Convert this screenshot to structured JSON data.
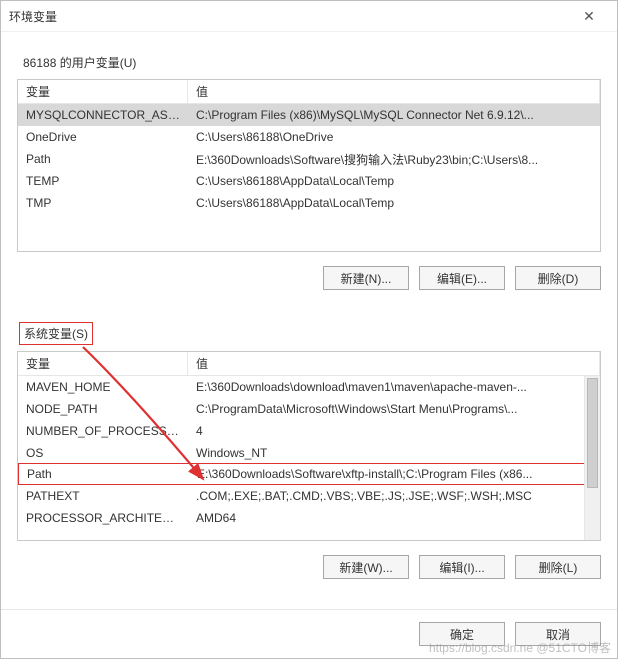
{
  "window": {
    "title": "环境变量",
    "close_glyph": "✕"
  },
  "user_section": {
    "label": "86188 的用户变量(U)",
    "headers": {
      "var": "变量",
      "val": "值"
    },
    "rows": [
      {
        "var": "MYSQLCONNECTOR_ASS...",
        "val": "C:\\Program Files (x86)\\MySQL\\MySQL Connector Net 6.9.12\\...",
        "selected": true
      },
      {
        "var": "OneDrive",
        "val": "C:\\Users\\86188\\OneDrive"
      },
      {
        "var": "Path",
        "val": "E:\\360Downloads\\Software\\搜狗输入法\\Ruby23\\bin;C:\\Users\\8..."
      },
      {
        "var": "TEMP",
        "val": "C:\\Users\\86188\\AppData\\Local\\Temp"
      },
      {
        "var": "TMP",
        "val": "C:\\Users\\86188\\AppData\\Local\\Temp"
      }
    ],
    "buttons": {
      "new": "新建(N)...",
      "edit": "编辑(E)...",
      "delete": "删除(D)"
    }
  },
  "system_section": {
    "label": "系统变量(S)",
    "headers": {
      "var": "变量",
      "val": "值"
    },
    "rows": [
      {
        "var": "MAVEN_HOME",
        "val": "E:\\360Downloads\\download\\maven1\\maven\\apache-maven-..."
      },
      {
        "var": "NODE_PATH",
        "val": "C:\\ProgramData\\Microsoft\\Windows\\Start Menu\\Programs\\..."
      },
      {
        "var": "NUMBER_OF_PROCESSORS",
        "val": "4"
      },
      {
        "var": "OS",
        "val": "Windows_NT"
      },
      {
        "var": "Path",
        "val": "E:\\360Downloads\\Software\\xftp-install\\;C:\\Program Files (x86...",
        "highlight": true
      },
      {
        "var": "PATHEXT",
        "val": ".COM;.EXE;.BAT;.CMD;.VBS;.VBE;.JS;.JSE;.WSF;.WSH;.MSC"
      },
      {
        "var": "PROCESSOR_ARCHITECT...",
        "val": "AMD64"
      }
    ],
    "buttons": {
      "new": "新建(W)...",
      "edit": "编辑(I)...",
      "delete": "删除(L)"
    }
  },
  "dialog_buttons": {
    "ok": "确定",
    "cancel": "取消"
  },
  "watermark": "https://blog.csdn.ne @51CTO博客",
  "annotation": {
    "color": "#e03131"
  }
}
